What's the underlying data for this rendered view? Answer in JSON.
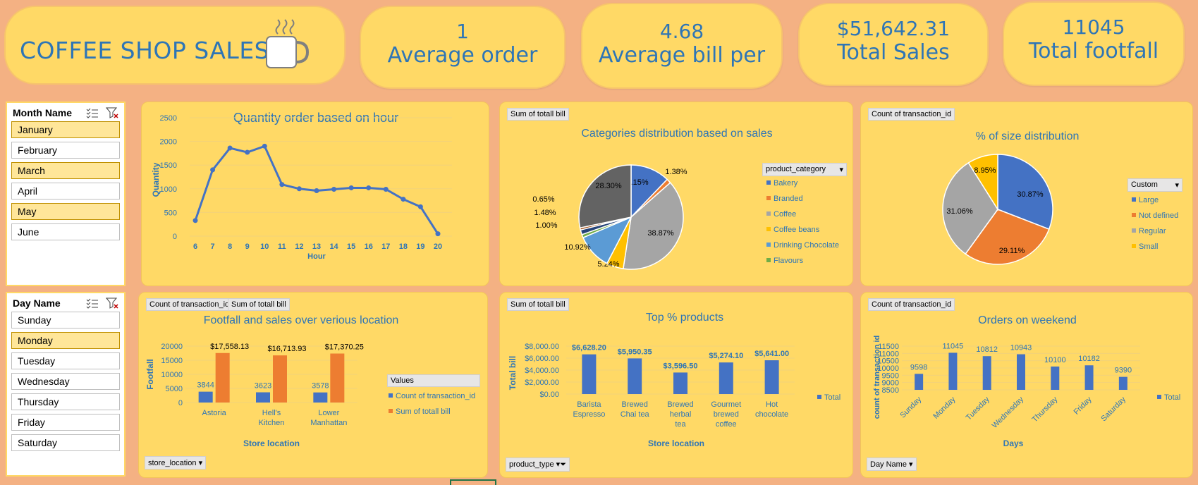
{
  "header": {
    "title": "COFFEE SHOP SALES",
    "icon": "coffee-mug-icon"
  },
  "kpis": [
    {
      "value": "1",
      "label": "Average order"
    },
    {
      "value": "4.68",
      "label": "Average bill per"
    },
    {
      "value": "$51,642.31",
      "label": "Total Sales"
    },
    {
      "value": "11045",
      "label": "Total footfall"
    }
  ],
  "month_slicer": {
    "title": "Month Name",
    "items": [
      "January",
      "February",
      "March",
      "April",
      "May",
      "June"
    ],
    "selected": [
      "January",
      "March",
      "May"
    ]
  },
  "day_slicer": {
    "title": "Day Name",
    "items": [
      "Sunday",
      "Monday",
      "Tuesday",
      "Wednesday",
      "Thursday",
      "Friday",
      "Saturday"
    ],
    "selected": [
      "Monday"
    ]
  },
  "field_buttons": {
    "sum_totall_bill": "Sum of totall bill",
    "count_transaction": "Count of transaction_id",
    "store_location": "store_location",
    "product_type": "product_type",
    "day_name": "Day Name",
    "product_category": "product_category",
    "custom": "Custom",
    "values": "Values"
  },
  "colors": {
    "blue": "#4472c4",
    "orange": "#ed7d31",
    "gray": "#a5a5a5",
    "gold": "#ffc000",
    "lightblue": "#5b9bd5",
    "green": "#70ad47",
    "dark": "#595959",
    "title": "#2e75b6"
  },
  "chart_data": [
    {
      "id": "hourly",
      "type": "line",
      "title": "Quantity order based on hour",
      "xlabel": "Hour",
      "ylabel": "Quantity",
      "x": [
        "6",
        "7",
        "8",
        "9",
        "10",
        "11",
        "12",
        "13",
        "14",
        "15",
        "16",
        "17",
        "18",
        "19",
        "20"
      ],
      "values": [
        330,
        1400,
        1860,
        1770,
        1900,
        1090,
        1000,
        960,
        990,
        1020,
        1020,
        990,
        780,
        620,
        50
      ],
      "yticks": [
        "0",
        "500",
        "1000",
        "1500",
        "2000",
        "2500"
      ],
      "ylim": [
        0,
        2500
      ]
    },
    {
      "id": "categories",
      "type": "pie",
      "title": "Categories distribution based on sales",
      "legend": [
        "Bakery",
        "Branded",
        "Coffee",
        "Coffee beans",
        "Drinking Chocolate",
        "Flavours"
      ],
      "slices": [
        {
          "name": "Bakery",
          "label": "12.15%",
          "value": 12.15,
          "color": "#4472c4"
        },
        {
          "name": "Branded",
          "label": "1.38%",
          "value": 1.38,
          "color": "#ed7d31"
        },
        {
          "name": "Coffee",
          "label": "38.87%",
          "value": 38.87,
          "color": "#a5a5a5"
        },
        {
          "name": "Coffee beans",
          "label": "5.24%",
          "value": 5.24,
          "color": "#ffc000"
        },
        {
          "name": "Drinking Chocolate",
          "label": "10.92%",
          "value": 10.92,
          "color": "#5b9bd5"
        },
        {
          "name": "Flavours",
          "label": "1.00%",
          "value": 1.0,
          "color": "#70ad47"
        },
        {
          "name": "",
          "label": "1.48%",
          "value": 1.48,
          "color": "#264478"
        },
        {
          "name": "",
          "label": "0.65%",
          "value": 0.65,
          "color": "#9e480e"
        },
        {
          "name": "",
          "label": "28.30%",
          "value": 28.3,
          "color": "#636363"
        }
      ]
    },
    {
      "id": "size",
      "type": "pie",
      "title": "% of size distribution",
      "legend": [
        "Large",
        "Not defined",
        "Regular",
        "Small"
      ],
      "slices": [
        {
          "name": "Large",
          "label": "30.87%",
          "value": 30.87,
          "color": "#4472c4"
        },
        {
          "name": "Not defined",
          "label": "29.11%",
          "value": 29.11,
          "color": "#ed7d31"
        },
        {
          "name": "Regular",
          "label": "31.06%",
          "value": 31.06,
          "color": "#a5a5a5"
        },
        {
          "name": "Small",
          "label": "8.95%",
          "value": 8.95,
          "color": "#ffc000"
        }
      ]
    },
    {
      "id": "location",
      "type": "bar",
      "title": "Footfall and sales  over verious location",
      "xlabel": "Store location",
      "ylabel": "Footfall",
      "categories": [
        "Astoria",
        "Hell's Kitchen",
        "Lower Manhattan"
      ],
      "series": [
        {
          "name": "Count of transaction_id",
          "values": [
            3844,
            3623,
            3578
          ],
          "labels": [
            "3844",
            "3623",
            "3578"
          ],
          "color": "#4472c4"
        },
        {
          "name": "Sum of totall bill",
          "values": [
            17558.13,
            16713.93,
            17370.25
          ],
          "labels": [
            "$17,558.13",
            "$16,713.93",
            "$17,370.25"
          ],
          "color": "#ed7d31"
        }
      ],
      "yticks": [
        "0",
        "5000",
        "10000",
        "15000",
        "20000"
      ],
      "ylim": [
        0,
        20000
      ]
    },
    {
      "id": "products",
      "type": "bar",
      "title": "Top %  products",
      "xlabel": "Store location",
      "ylabel": "Total bill",
      "categories": [
        "Barista Espresso",
        "Brewed Chai tea",
        "Brewed herbal tea",
        "Gourmet brewed coffee",
        "Hot chocolate"
      ],
      "values": [
        6628.2,
        5950.35,
        3596.5,
        5274.1,
        5641.0
      ],
      "labels": [
        "$6,628.20",
        "$5,950.35",
        "$3,596.50",
        "$5,274.10",
        "$5,641.00"
      ],
      "legend": "Total",
      "yticks": [
        "$0.00",
        "$2,000.00",
        "$4,000.00",
        "$6,000.00",
        "$8,000.00"
      ],
      "ylim": [
        0,
        8000
      ]
    },
    {
      "id": "weekend",
      "type": "bar",
      "title": "Orders on weekend",
      "xlabel": "Days",
      "ylabel": "count of transaction id",
      "categories": [
        "Sunday",
        "Monday",
        "Tuesday",
        "Wednesday",
        "Thursday",
        "Friday",
        "Saturday"
      ],
      "values": [
        9598,
        11045,
        10812,
        10943,
        10100,
        10182,
        9390
      ],
      "labels": [
        "9598",
        "11045",
        "10812",
        "10943",
        "10100",
        "10182",
        "9390"
      ],
      "legend": "Total",
      "yticks": [
        "8500",
        "9000",
        "9500",
        "10000",
        "10500",
        "11000",
        "11500"
      ],
      "ylim": [
        8500,
        11500
      ]
    }
  ]
}
